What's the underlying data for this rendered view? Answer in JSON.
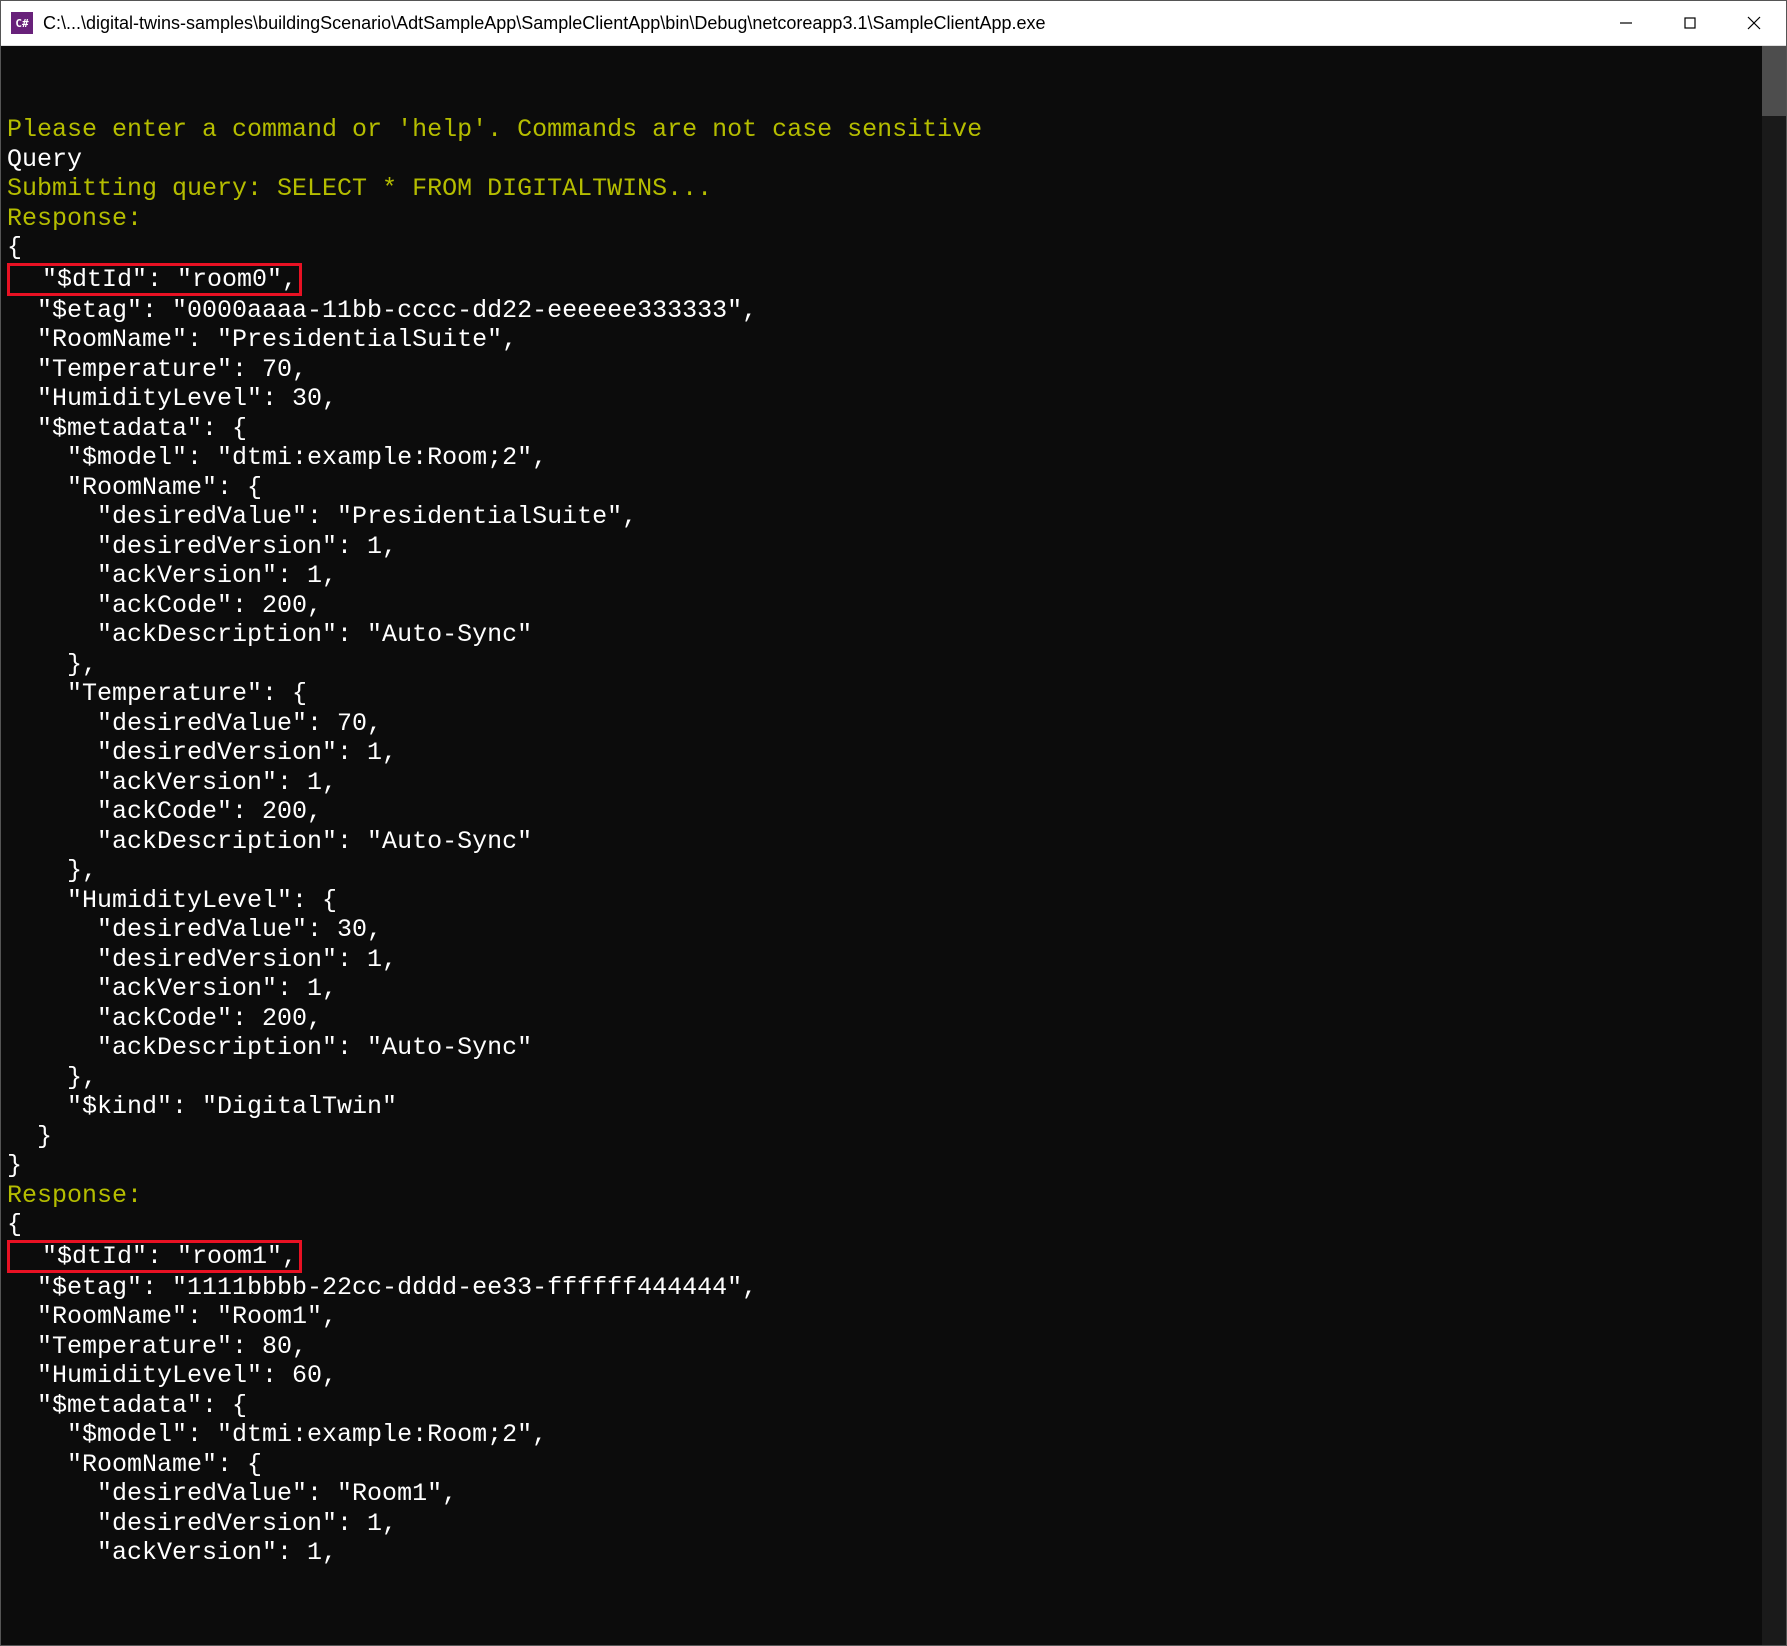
{
  "titlebar": {
    "icon_label": "C#",
    "path": "C:\\...\\digital-twins-samples\\buildingScenario\\AdtSampleApp\\SampleClientApp\\bin\\Debug\\netcoreapp3.1\\SampleClientApp.exe"
  },
  "controls": {
    "min": "minimize",
    "max": "maximize",
    "close": "close"
  },
  "console": {
    "prompt": "Please enter a command or 'help'. Commands are not case sensitive",
    "cmd": "Query",
    "submit": "Submitting query: SELECT * FROM DIGITALTWINS...",
    "response_label": "Response:",
    "r0": {
      "open": "{",
      "dtid": "  \"$dtId\": \"room0\",",
      "etag": "  \"$etag\": \"0000aaaa-11bb-cccc-dd22-eeeeee333333\",",
      "roomname": "  \"RoomName\": \"PresidentialSuite\",",
      "temp": "  \"Temperature\": 70,",
      "hum": "  \"HumidityLevel\": 30,",
      "meta_open": "  \"$metadata\": {",
      "model": "    \"$model\": \"dtmi:example:Room;2\",",
      "rn_open": "    \"RoomName\": {",
      "rn_dv": "      \"desiredValue\": \"PresidentialSuite\",",
      "rn_dver": "      \"desiredVersion\": 1,",
      "rn_av": "      \"ackVersion\": 1,",
      "rn_ac": "      \"ackCode\": 200,",
      "rn_ad": "      \"ackDescription\": \"Auto-Sync\"",
      "rn_close": "    },",
      "t_open": "    \"Temperature\": {",
      "t_dv": "      \"desiredValue\": 70,",
      "t_dver": "      \"desiredVersion\": 1,",
      "t_av": "      \"ackVersion\": 1,",
      "t_ac": "      \"ackCode\": 200,",
      "t_ad": "      \"ackDescription\": \"Auto-Sync\"",
      "t_close": "    },",
      "h_open": "    \"HumidityLevel\": {",
      "h_dv": "      \"desiredValue\": 30,",
      "h_dver": "      \"desiredVersion\": 1,",
      "h_av": "      \"ackVersion\": 1,",
      "h_ac": "      \"ackCode\": 200,",
      "h_ad": "      \"ackDescription\": \"Auto-Sync\"",
      "h_close": "    },",
      "kind": "    \"$kind\": \"DigitalTwin\"",
      "meta_close": "  }",
      "close": "}"
    },
    "r1": {
      "open": "{",
      "dtid": "  \"$dtId\": \"room1\",",
      "etag": "  \"$etag\": \"1111bbbb-22cc-dddd-ee33-ffffff444444\",",
      "roomname": "  \"RoomName\": \"Room1\",",
      "temp": "  \"Temperature\": 80,",
      "hum": "  \"HumidityLevel\": 60,",
      "meta_open": "  \"$metadata\": {",
      "model": "    \"$model\": \"dtmi:example:Room;2\",",
      "rn_open": "    \"RoomName\": {",
      "rn_dv": "      \"desiredValue\": \"Room1\",",
      "rn_dver": "      \"desiredVersion\": 1,",
      "rn_av": "      \"ackVersion\": 1,"
    }
  }
}
